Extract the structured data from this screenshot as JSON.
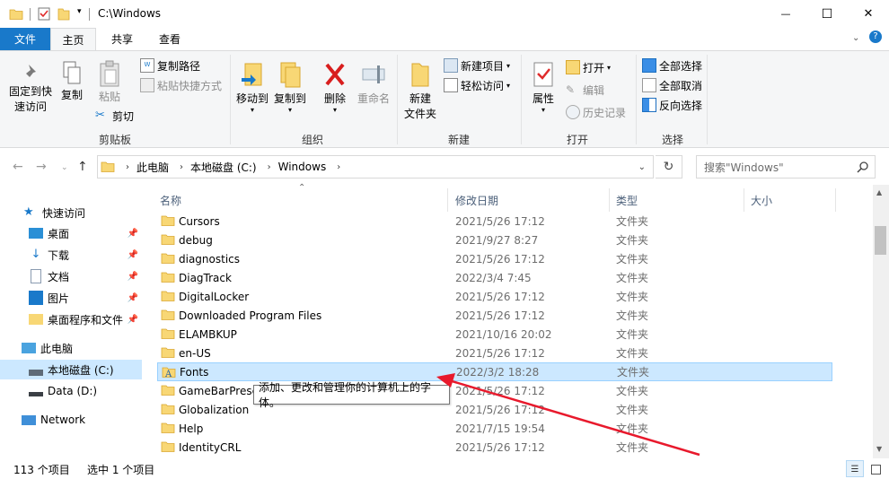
{
  "window": {
    "title": "C:\\Windows",
    "minimize": "—",
    "maximize": "☐",
    "close": "✕"
  },
  "tabs": {
    "file": "文件",
    "home": "主页",
    "share": "共享",
    "view": "查看"
  },
  "ribbon": {
    "clipboard": {
      "label": "剪贴板",
      "pin_quick": "固定到快\n速访问",
      "copy": "复制",
      "paste": "粘贴",
      "copy_path": "复制路径",
      "paste_shortcut": "粘贴快捷方式",
      "cut": "剪切"
    },
    "organize": {
      "label": "组织",
      "move_to": "移动到",
      "copy_to": "复制到",
      "delete": "删除",
      "rename": "重命名"
    },
    "new": {
      "label": "新建",
      "new_folder": "新建\n文件夹",
      "new_item": "新建项目",
      "easy_access": "轻松访问"
    },
    "open": {
      "label": "打开",
      "properties": "属性",
      "open": "打开",
      "edit": "编辑",
      "history": "历史记录"
    },
    "select": {
      "label": "选择",
      "select_all": "全部选择",
      "select_none": "全部取消",
      "invert": "反向选择"
    }
  },
  "address": {
    "crumbs": [
      "此电脑",
      "本地磁盘 (C:)",
      "Windows"
    ],
    "search_placeholder": "搜索\"Windows\""
  },
  "navpane": {
    "quick_access": "快速访问",
    "desktop": "桌面",
    "downloads": "下载",
    "documents": "文档",
    "pictures": "图片",
    "desktop_files": "桌面程序和文件",
    "this_pc": "此电脑",
    "local_disk": "本地磁盘 (C:)",
    "data_disk": "Data (D:)",
    "network": "Network"
  },
  "columns": {
    "name": "名称",
    "date": "修改日期",
    "type": "类型",
    "size": "大小"
  },
  "files": [
    {
      "name": "Cursors",
      "date": "2021/5/26 17:12",
      "type": "文件夹"
    },
    {
      "name": "debug",
      "date": "2021/9/27 8:27",
      "type": "文件夹"
    },
    {
      "name": "diagnostics",
      "date": "2021/5/26 17:12",
      "type": "文件夹"
    },
    {
      "name": "DiagTrack",
      "date": "2022/3/4 7:45",
      "type": "文件夹"
    },
    {
      "name": "DigitalLocker",
      "date": "2021/5/26 17:12",
      "type": "文件夹"
    },
    {
      "name": "Downloaded Program Files",
      "date": "2021/5/26 17:12",
      "type": "文件夹"
    },
    {
      "name": "ELAMBKUP",
      "date": "2021/10/16 20:02",
      "type": "文件夹"
    },
    {
      "name": "en-US",
      "date": "2021/5/26 17:12",
      "type": "文件夹"
    },
    {
      "name": "Fonts",
      "date": "2022/3/2 18:28",
      "type": "文件夹"
    },
    {
      "name": "GameBarPresenceWriter",
      "date": "2021/5/26 17:12",
      "type": "文件夹"
    },
    {
      "name": "Globalization",
      "date": "2021/5/26 17:12",
      "type": "文件夹"
    },
    {
      "name": "Help",
      "date": "2021/7/15 19:54",
      "type": "文件夹"
    },
    {
      "name": "IdentityCRL",
      "date": "2021/5/26 17:12",
      "type": "文件夹"
    }
  ],
  "tooltip": "添加、更改和管理你的计算机上的字体。",
  "status": {
    "count": "113 个项目",
    "selected": "选中 1 个项目"
  },
  "colors": {
    "accent": "#1979ca",
    "selection": "#cce8ff",
    "folder": "#f8d775",
    "arrow": "#e8192c"
  }
}
